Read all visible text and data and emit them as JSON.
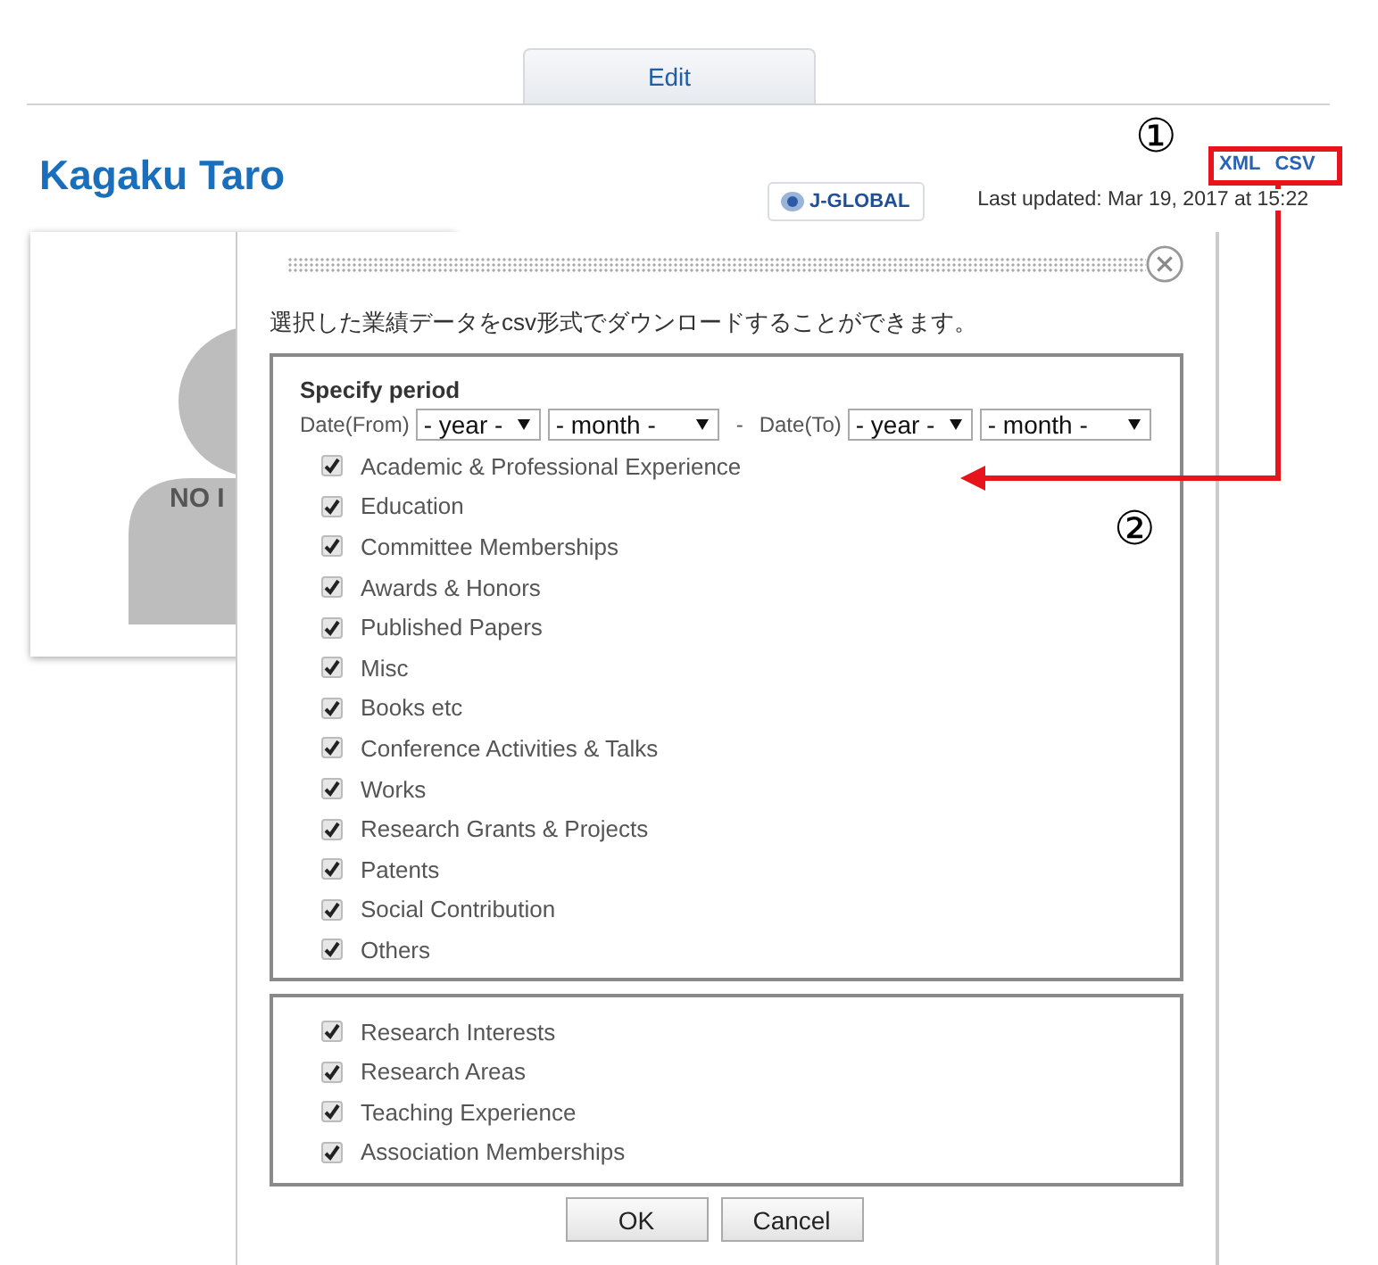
{
  "tab": {
    "label": "Edit",
    "selected": true
  },
  "profile": {
    "name": "Kagaku Taro",
    "badge": "J-GLOBAL",
    "last_updated": "Last updated: Mar 19, 2017 at 15:22",
    "downloads": [
      "XML",
      "CSV"
    ],
    "avatar_text": "NO I"
  },
  "dialog": {
    "message": "選択した業績データをcsv形式でダウンロードすることができます。",
    "period": {
      "title": "Specify period",
      "from_label": "Date(From)",
      "separator": "-",
      "to_label": "Date(To)",
      "selects": [
        "- year -",
        "- month -",
        "- year -",
        "- month -"
      ]
    },
    "groups": [
      [
        {
          "label": "Academic & Professional Experience",
          "checked": true
        },
        {
          "label": "Education",
          "checked": true
        },
        {
          "label": "Committee Memberships",
          "checked": true
        },
        {
          "label": "Awards & Honors",
          "checked": true
        },
        {
          "label": "Published Papers",
          "checked": true
        },
        {
          "label": "Misc",
          "checked": true
        },
        {
          "label": "Books etc",
          "checked": true
        },
        {
          "label": "Conference Activities & Talks",
          "checked": true
        },
        {
          "label": "Works",
          "checked": true
        },
        {
          "label": "Research Grants & Projects",
          "checked": true
        },
        {
          "label": "Patents",
          "checked": true
        },
        {
          "label": "Social Contribution",
          "checked": true
        },
        {
          "label": "Others",
          "checked": true
        }
      ],
      [
        {
          "label": "Research Interests",
          "checked": true
        },
        {
          "label": "Research Areas",
          "checked": true
        },
        {
          "label": "Teaching Experience",
          "checked": true
        },
        {
          "label": "Association Memberships",
          "checked": true
        }
      ]
    ],
    "buttons": [
      "OK",
      "Cancel"
    ]
  },
  "annotations": [
    "①",
    "②"
  ]
}
